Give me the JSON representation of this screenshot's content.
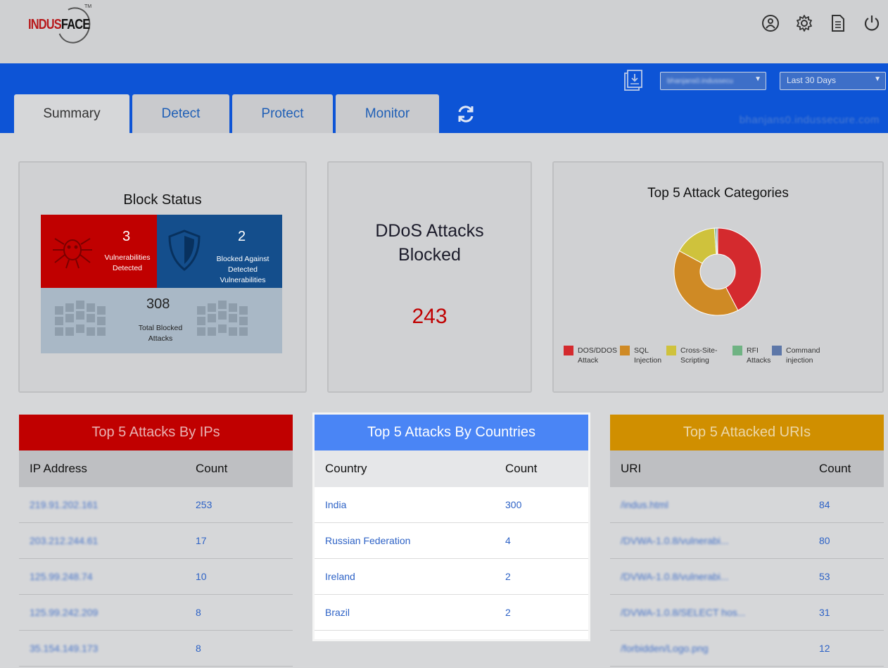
{
  "header": {
    "logo_indus": "INDUS",
    "logo_face": "FACE",
    "logo_tm": "TM",
    "icons": [
      "user-icon",
      "gear-icon",
      "document-icon",
      "power-icon"
    ]
  },
  "toolbar": {
    "site_select": "bhanjans0.indussecu",
    "range_select": "Last 30 Days",
    "domain": "bhanjans0.indussecure.com"
  },
  "tabs": [
    "Summary",
    "Detect",
    "Protect",
    "Monitor"
  ],
  "block_status": {
    "title": "Block Status",
    "vuln_count": "3",
    "vuln_label": "Vulnerabilities Detected",
    "blocked_count": "2",
    "blocked_label": "Blocked Against Detected Vulnerabilities",
    "total_count": "308",
    "total_label": "Total Blocked Attacks"
  },
  "ddos": {
    "title_line1": "DDoS Attacks",
    "title_line2": "Blocked",
    "value": "243"
  },
  "categories": {
    "title": "Top 5 Attack Categories",
    "legend": [
      {
        "label": "DOS/DDOS Attack",
        "color": "#d42a2e"
      },
      {
        "label": "SQL Injection",
        "color": "#cf8a25"
      },
      {
        "label": "Cross-Site-Scripting",
        "color": "#cfc23c"
      },
      {
        "label": "RFI Attacks",
        "color": "#6fb383"
      },
      {
        "label": "Command injection",
        "color": "#5d77a8"
      }
    ]
  },
  "chart_data": {
    "type": "pie",
    "categories": [
      "DOS/DDOS Attack",
      "SQL Injection",
      "Cross-Site-Scripting",
      "RFI Attacks",
      "Command injection"
    ],
    "values": [
      243,
      233,
      91,
      4,
      3
    ],
    "colors": [
      "#d42a2e",
      "#cf8a25",
      "#cfc23c",
      "#6fb383",
      "#5d77a8"
    ],
    "title": "Top 5 Attack Categories",
    "legend": "bottom"
  },
  "ips": {
    "title": "Top 5 Attacks By IPs",
    "col1": "IP Address",
    "col2": "Count",
    "rows": [
      {
        "key": "219.91.202.161",
        "count": "253"
      },
      {
        "key": "203.212.244.61",
        "count": "17"
      },
      {
        "key": "125.99.248.74",
        "count": "10"
      },
      {
        "key": "125.99.242.209",
        "count": "8"
      },
      {
        "key": "35.154.149.173",
        "count": "8"
      }
    ]
  },
  "countries": {
    "title": "Top 5 Attacks By Countries",
    "col1": "Country",
    "col2": "Count",
    "rows": [
      {
        "key": "India",
        "count": "300"
      },
      {
        "key": "Russian Federation",
        "count": "4"
      },
      {
        "key": "Ireland",
        "count": "2"
      },
      {
        "key": "Brazil",
        "count": "2"
      }
    ]
  },
  "uris": {
    "title": "Top 5 Attacked URIs",
    "col1": "URI",
    "col2": "Count",
    "rows": [
      {
        "key": "/indus.html",
        "count": "84"
      },
      {
        "key": "/DVWA-1.0.8/vulnerabi...",
        "count": "80"
      },
      {
        "key": "/DVWA-1.0.8/vulnerabi...",
        "count": "53"
      },
      {
        "key": "/DVWA-1.0.8/SELECT hos...",
        "count": "31"
      },
      {
        "key": "/forbidden/Logo.png",
        "count": "12"
      }
    ]
  }
}
